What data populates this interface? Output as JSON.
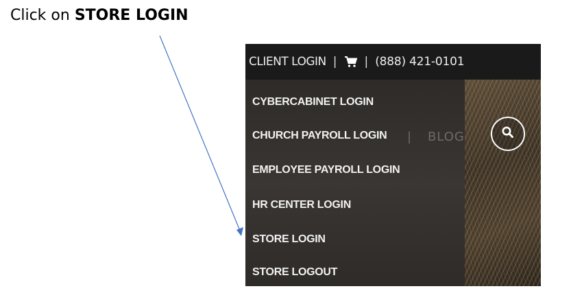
{
  "instruction": {
    "prefix": "Click on ",
    "target": "STORE LOGIN"
  },
  "topbar": {
    "client_login": "CLIENT LOGIN",
    "separator": "|",
    "cart_icon": "shopping-cart-icon",
    "phone": "(888) 421-0101"
  },
  "background_nav": {
    "pipe": "|",
    "blog": "BLOG"
  },
  "search": {
    "icon": "search-icon"
  },
  "dropdown": {
    "items": [
      {
        "label": "CYBERCABINET LOGIN"
      },
      {
        "label": "CHURCH PAYROLL LOGIN"
      },
      {
        "label": "EMPLOYEE PAYROLL LOGIN"
      },
      {
        "label": "HR CENTER LOGIN"
      },
      {
        "label": "STORE LOGIN"
      },
      {
        "label": "STORE LOGOUT"
      }
    ]
  },
  "colors": {
    "arrow": "#4472C4",
    "topbar_bg": "#1a1a1a",
    "dropdown_text": "#f2f2f2"
  }
}
